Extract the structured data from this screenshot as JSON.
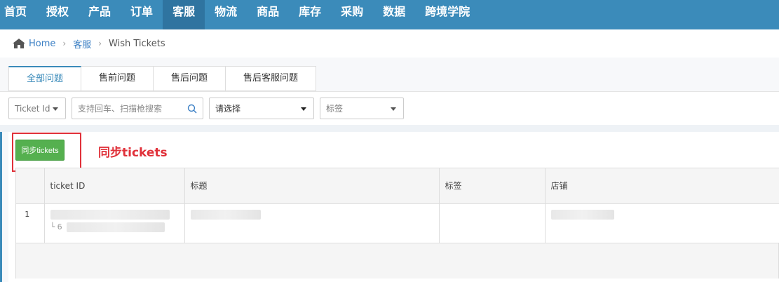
{
  "nav": {
    "items": [
      {
        "label": "首页"
      },
      {
        "label": "授权"
      },
      {
        "label": "产品"
      },
      {
        "label": "订单"
      },
      {
        "label": "客服",
        "active": true
      },
      {
        "label": "物流"
      },
      {
        "label": "商品"
      },
      {
        "label": "库存"
      },
      {
        "label": "采购"
      },
      {
        "label": "数据"
      },
      {
        "label": "跨境学院"
      }
    ]
  },
  "breadcrumb": {
    "home_icon": "home-icon",
    "home": "Home",
    "section": "客服",
    "current": "Wish Tickets"
  },
  "tabs": [
    {
      "label": "全部问题",
      "active": true
    },
    {
      "label": "售前问题"
    },
    {
      "label": "售后问题"
    },
    {
      "label": "售后客服问题"
    }
  ],
  "filters": {
    "field_select": "Ticket Id",
    "search_placeholder": "支持回车、扫描枪搜索",
    "search_icon": "search-icon",
    "status_select": "请选择",
    "tag_select": "标签"
  },
  "actions": {
    "sync_button": "同步tickets",
    "annotation": "同步tickets"
  },
  "table": {
    "columns": [
      "",
      "ticket ID",
      "标题",
      "标签",
      "店铺"
    ],
    "rows": [
      {
        "index": "1",
        "ticket_prefix": "└ 6"
      }
    ]
  },
  "colors": {
    "nav_bg": "#3b8bba",
    "nav_active": "#2f74a0",
    "sync_button": "#55b04f",
    "annotation": "#e0313a"
  }
}
